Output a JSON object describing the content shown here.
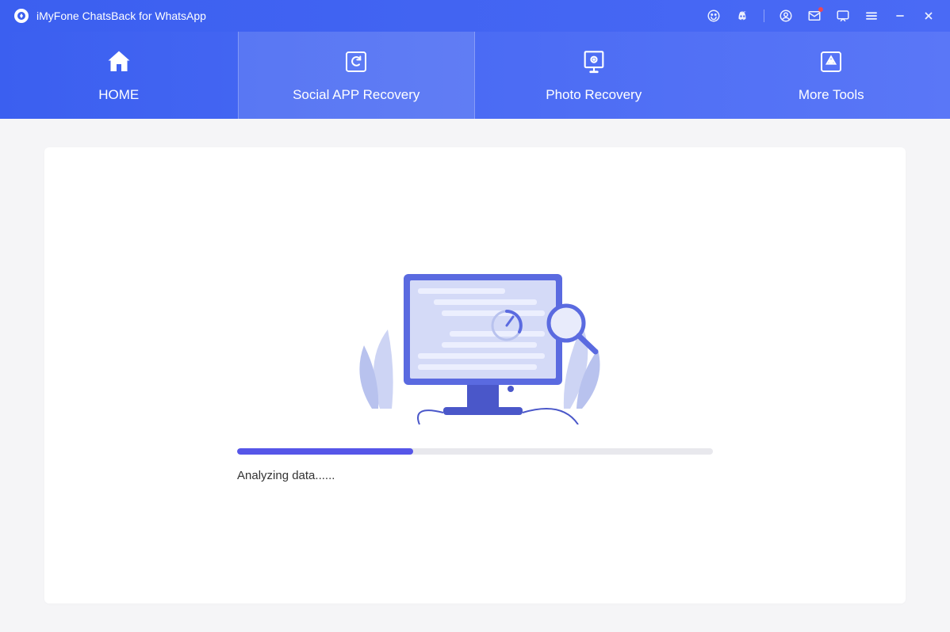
{
  "app": {
    "title": "iMyFone ChatsBack for WhatsApp"
  },
  "nav": {
    "items": [
      {
        "label": "HOME",
        "icon": "home"
      },
      {
        "label": "Social APP Recovery",
        "icon": "refresh"
      },
      {
        "label": "Photo Recovery",
        "icon": "photo"
      },
      {
        "label": "More Tools",
        "icon": "tools"
      }
    ],
    "activeIndex": 1
  },
  "progress": {
    "percent": 37,
    "statusText": "Analyzing data......"
  }
}
